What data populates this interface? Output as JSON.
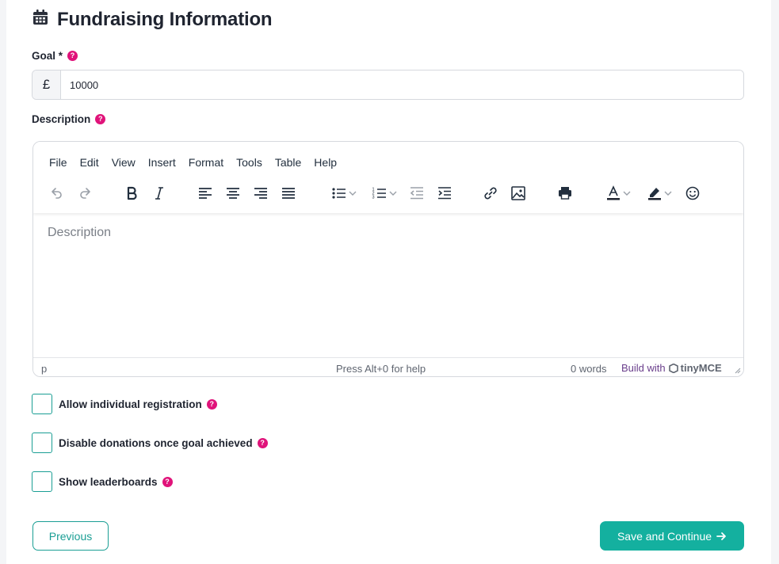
{
  "section": {
    "title": "Fundraising Information",
    "icon": "calendar-icon"
  },
  "colors": {
    "accent": "#14b09f",
    "help_badge": "#e0137a",
    "text": "#1f2430"
  },
  "goal": {
    "label": "Goal *",
    "help": "?",
    "currency_symbol": "£",
    "value": "10000"
  },
  "description": {
    "label": "Description",
    "help": "?"
  },
  "editor": {
    "menu": [
      "File",
      "Edit",
      "View",
      "Insert",
      "Format",
      "Tools",
      "Table",
      "Help"
    ],
    "toolbar_icons": [
      "undo-icon",
      "redo-icon",
      "bold-icon",
      "italic-icon",
      "align-left-icon",
      "align-center-icon",
      "align-right-icon",
      "align-justify-icon",
      "bullet-list-icon",
      "numbered-list-icon",
      "outdent-icon",
      "indent-icon",
      "link-icon",
      "image-icon",
      "print-icon",
      "text-color-icon",
      "highlight-color-icon",
      "emoji-icon"
    ],
    "placeholder": "Description",
    "status_path": "p",
    "status_help": "Press Alt+0 for help",
    "word_count": "0 words",
    "build_with": "Build with",
    "brand": "tinyMCE"
  },
  "options": [
    {
      "label": "Allow individual registration",
      "help": "?",
      "checked": false
    },
    {
      "label": "Disable donations once goal achieved",
      "help": "?",
      "checked": false
    },
    {
      "label": "Show leaderboards",
      "help": "?",
      "checked": false
    }
  ],
  "actions": {
    "previous": "Previous",
    "save": "Save and Continue",
    "save_icon": "arrow-right-icon"
  }
}
